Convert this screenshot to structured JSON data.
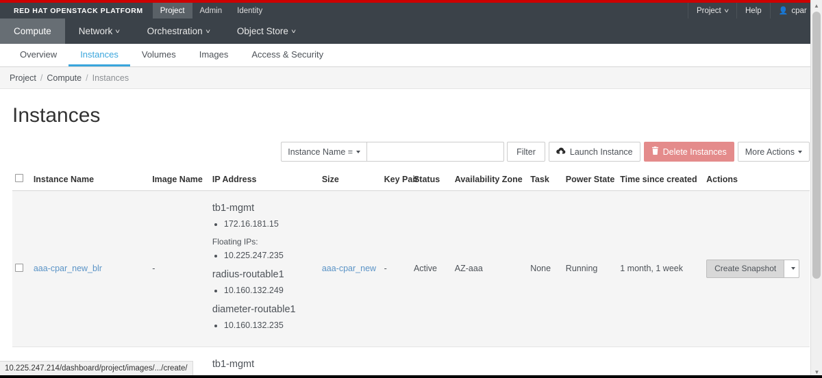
{
  "masthead": {
    "brand": "RED HAT OPENSTACK PLATFORM",
    "tabs": [
      {
        "label": "Project",
        "active": true
      },
      {
        "label": "Admin",
        "active": false
      },
      {
        "label": "Identity",
        "active": false
      }
    ],
    "right": {
      "project": "Project",
      "help": "Help",
      "user": "cpar",
      "user_icon": "user-icon"
    }
  },
  "mainnav": {
    "items": [
      {
        "label": "Compute",
        "active": true,
        "caret": false
      },
      {
        "label": "Network",
        "active": false,
        "caret": true
      },
      {
        "label": "Orchestration",
        "active": false,
        "caret": true
      },
      {
        "label": "Object Store",
        "active": false,
        "caret": true
      }
    ]
  },
  "subnav": {
    "tabs": [
      {
        "label": "Overview",
        "active": false
      },
      {
        "label": "Instances",
        "active": true
      },
      {
        "label": "Volumes",
        "active": false
      },
      {
        "label": "Images",
        "active": false
      },
      {
        "label": "Access & Security",
        "active": false
      }
    ]
  },
  "breadcrumb": {
    "items": [
      "Project",
      "Compute",
      "Instances"
    ],
    "separator": "/"
  },
  "page": {
    "title": "Instances"
  },
  "toolbar": {
    "filter_select": "Instance Name =",
    "filter_input_value": "",
    "filter_input_placeholder": "",
    "filter_button": "Filter",
    "launch_button": "Launch Instance",
    "launch_icon": "cloud-upload-icon",
    "delete_button": "Delete Instances",
    "delete_icon": "trash-icon",
    "more_actions": "More Actions",
    "delete_color": "#e48b8b"
  },
  "table": {
    "columns": [
      "Instance Name",
      "Image Name",
      "IP Address",
      "Size",
      "Key Pair",
      "Status",
      "Availability Zone",
      "Task",
      "Power State",
      "Time since created",
      "Actions"
    ],
    "rows": [
      {
        "name": "aaa-cpar_new_blr",
        "image_name": "-",
        "networks": [
          {
            "network": "tb1-mgmt",
            "ips": [
              "172.16.181.15"
            ],
            "floating_label": "Floating IPs:",
            "floating_ips": [
              "10.225.247.235"
            ]
          },
          {
            "network": "radius-routable1",
            "ips": [
              "10.160.132.249"
            ]
          },
          {
            "network": "diameter-routable1",
            "ips": [
              "10.160.132.235"
            ]
          }
        ],
        "size": "aaa-cpar_new",
        "key_pair": "-",
        "status": "Active",
        "availability_zone": "AZ-aaa",
        "task": "None",
        "power_state": "Running",
        "time_since_created": "1 month, 1 week",
        "action_label": "Create Snapshot"
      },
      {
        "network_partial": "tb1-mgmt"
      }
    ]
  },
  "statusbar": {
    "url": "10.225.247.214/dashboard/project/images/.../create/"
  }
}
